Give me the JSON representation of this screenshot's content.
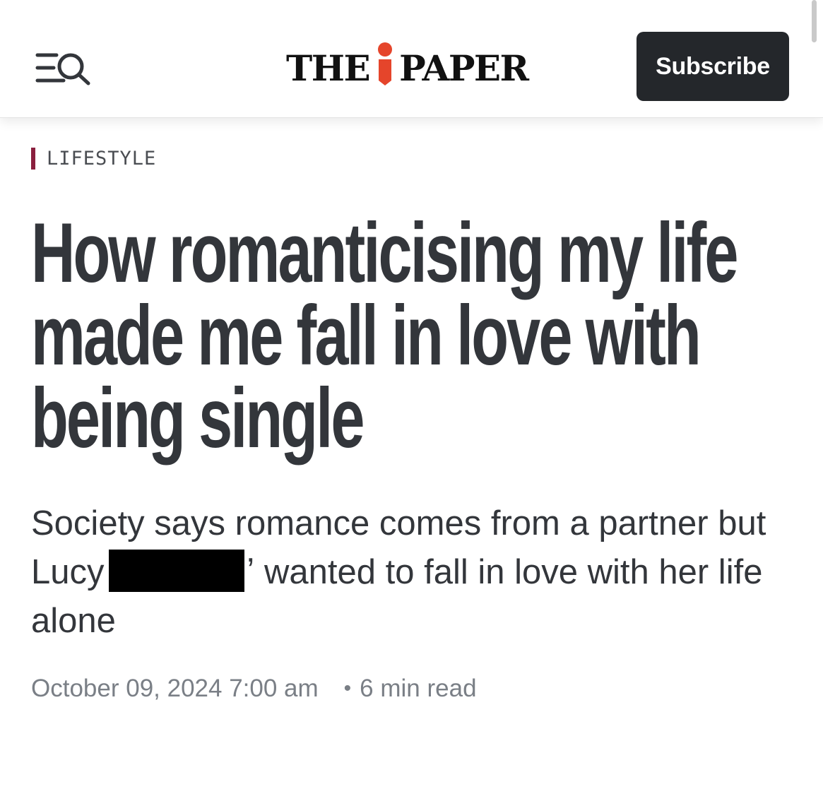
{
  "header": {
    "logo_left": "THE",
    "logo_right": "PAPER",
    "logo_i": "i",
    "subscribe_label": "Subscribe",
    "accent_color": "#e5452b",
    "icons": [
      "menu-search-icon"
    ]
  },
  "article": {
    "category": "LIFESTYLE",
    "category_color": "#8a1f3e",
    "headline": "How romanticising my life made me fall in love with being single",
    "standfirst_before": "Society says romance comes from a partner but Lucy",
    "standfirst_after": "ʼ wanted to fall in love with her life alone",
    "date": "October 09, 2024 7:00 am",
    "dot": "•",
    "read_time": "6 min read"
  }
}
